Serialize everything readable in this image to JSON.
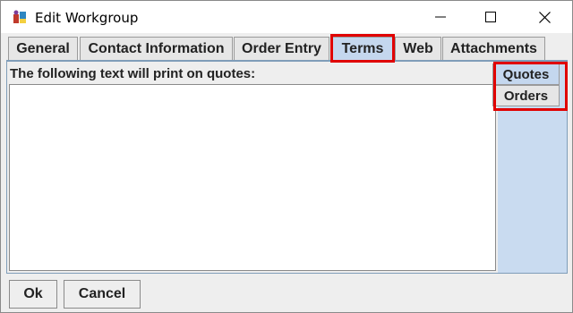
{
  "window": {
    "title": "Edit Workgroup",
    "icon": "app-icon",
    "controls": {
      "minimize": "minimize-icon",
      "maximize": "maximize-icon",
      "close": "close-icon"
    }
  },
  "tabs": [
    {
      "label": "General"
    },
    {
      "label": "Contact Information"
    },
    {
      "label": "Order Entry"
    },
    {
      "label": "Terms",
      "selected": true
    },
    {
      "label": "Web"
    },
    {
      "label": "Attachments"
    }
  ],
  "panel": {
    "label": "The following text will print on quotes:",
    "text_value": ""
  },
  "side_tabs": [
    {
      "label": "Quotes",
      "selected": true
    },
    {
      "label": "Orders"
    }
  ],
  "buttons": {
    "ok": "Ok",
    "cancel": "Cancel"
  },
  "colors": {
    "highlight": "#e00000",
    "selected_tab": "#c4d7ee",
    "content_bg": "#c9dbf0"
  }
}
